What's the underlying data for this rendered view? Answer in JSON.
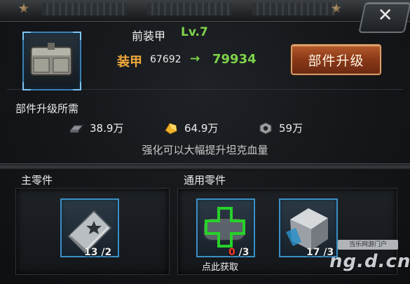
{
  "close_label": "✕",
  "item": {
    "name": "前装甲",
    "level": "Lv.7",
    "stat_label": "装甲",
    "stat_current": "67692",
    "arrow": "→",
    "stat_next": "79934"
  },
  "upgrade_button_label": "部件升级",
  "requirements": {
    "title": "部件升级所需",
    "items": [
      {
        "icon": "iron-bar-icon",
        "value": "38.9万"
      },
      {
        "icon": "gold-ore-icon",
        "value": "64.9万"
      },
      {
        "icon": "nut-icon",
        "value": "59万"
      }
    ],
    "hint": "强化可以大幅提升坦克血量"
  },
  "main_parts": {
    "title": "主零件",
    "slots": [
      {
        "icon": "blueprint-book-icon",
        "owned": "13",
        "needed": "/2"
      }
    ]
  },
  "common_parts": {
    "title": "通用零件",
    "slots": [
      {
        "icon": "armor-plate-plus-icon",
        "owned": "0",
        "needed": "/3",
        "action": "点此获取"
      },
      {
        "icon": "steel-cube-icon",
        "owned": "17",
        "needed": "/3"
      }
    ]
  },
  "watermark": {
    "top": "当乐网游门户",
    "main": "ng.d.cn"
  },
  "colors": {
    "level_green": "#7fd34a",
    "stat_orange": "#f2a93c",
    "slot_border": "#3c8fc4",
    "shortage_red": "#ff3a2a",
    "upgrade_button": "#8a3818"
  }
}
